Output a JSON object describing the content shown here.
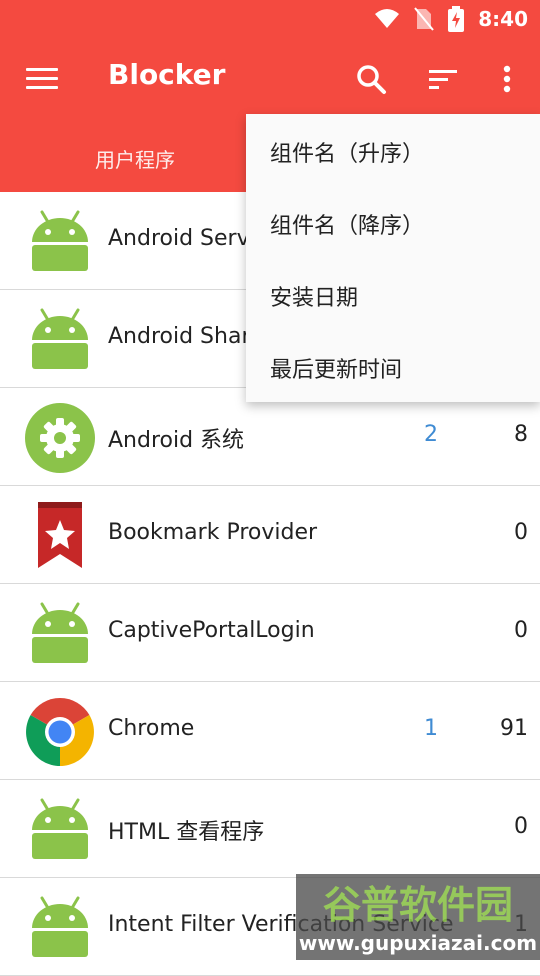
{
  "status_bar": {
    "time": "8:40"
  },
  "toolbar": {
    "title": "Blocker",
    "menu_icon": "menu-icon",
    "search_icon": "search-icon",
    "sort_icon": "sort-icon",
    "overflow_icon": "more-vert-icon"
  },
  "tabs": {
    "user_apps": "用户程序"
  },
  "apps": [
    {
      "name": "Android Serv",
      "blue": "",
      "count": "",
      "icon": "android-icon"
    },
    {
      "name": "Android Shar",
      "blue": "",
      "count": "",
      "icon": "android-icon"
    },
    {
      "name": "Android 系统",
      "blue": "2",
      "count": "8",
      "icon": "settings-gear-icon"
    },
    {
      "name": "Bookmark Provider",
      "blue": "",
      "count": "0",
      "icon": "bookmark-icon"
    },
    {
      "name": "CaptivePortalLogin",
      "blue": "",
      "count": "0",
      "icon": "android-icon"
    },
    {
      "name": "Chrome",
      "blue": "1",
      "count": "91",
      "icon": "chrome-icon"
    },
    {
      "name": "HTML 查看程序",
      "blue": "",
      "count": "0",
      "icon": "android-icon"
    },
    {
      "name": "Intent Filter Verification Service",
      "blue": "",
      "count": "1",
      "icon": "android-icon"
    }
  ],
  "sort_menu": {
    "items": [
      "组件名（升序）",
      "组件名（降序）",
      "安装日期",
      "最后更新时间"
    ]
  },
  "watermark": {
    "title": "谷普软件园",
    "url": "www.gupuxiazai.com"
  },
  "colors": {
    "primary": "#f44a40",
    "accent_blue": "#3f8bd3",
    "android_green": "#8bc34a"
  }
}
